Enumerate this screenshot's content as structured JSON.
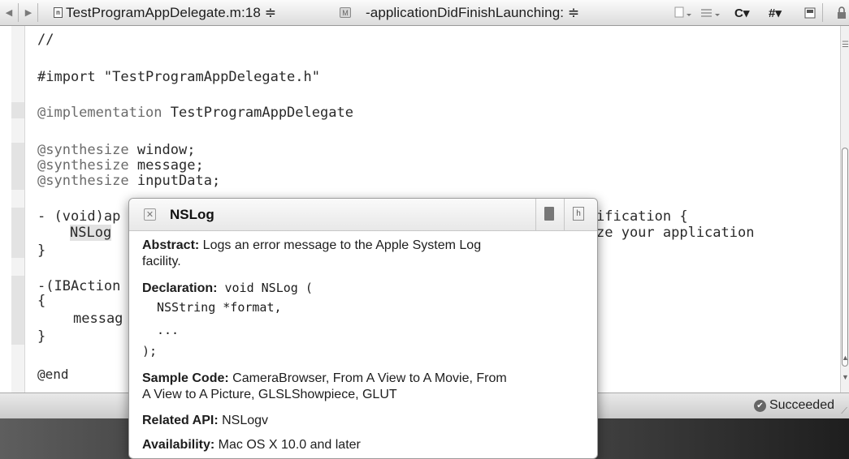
{
  "jumpbar": {
    "back_arrow": "◀",
    "forward_arrow": "▶",
    "file_icon_glyph": "m",
    "file_crumb": "TestProgramAppDelegate.m:18 ≑",
    "method_icon_glyph": "M",
    "method_crumb": "-applicationDidFinishLaunching: ≑",
    "icons": [
      "doc-menu-icon",
      "lines-menu-icon",
      "counterparts-icon",
      "includes-icon",
      "split-editor-icon",
      "lock-icon"
    ],
    "counterparts_label": "C▾",
    "includes_label": "#▾"
  },
  "code": {
    "l1": "//",
    "l2": "#import \"TestProgramAppDelegate.h\"",
    "l3_kw": "@implementation",
    "l3_rest": " TestProgramAppDelegate",
    "l4_kw": "@synthesize",
    "l4_rest": " window;",
    "l5_kw": "@synthesize",
    "l5_rest": " message;",
    "l6_kw": "@synthesize",
    "l6_rest": " inputData;",
    "l7_left": "- (void)ap",
    "l7_right": "ification {",
    "l8_left": "NSLog",
    "l8_right": "ze your application",
    "l9": "}",
    "l10": "-(IBAction",
    "l11": "{",
    "l12": "messag",
    "l13": "}",
    "l14": "@end"
  },
  "popover": {
    "title": "NSLog",
    "abstract_label": "Abstract:",
    "abstract_text1": " Logs an error message to the Apple System Log",
    "abstract_text2": "facility.",
    "declaration_label": "Declaration:",
    "declaration_sig": " void NSLog (",
    "decl_param": "NSString *format,",
    "decl_ellipsis": "...",
    "decl_close": ");",
    "sample_label": "Sample Code:",
    "sample_text1": " CameraBrowser, From A View to A Movie, From",
    "sample_text2": "A View to A Picture, GLSLShowpiece, GLUT",
    "related_label": "Related API:",
    "related_text": " NSLogv",
    "availability_label": "Availability:",
    "availability_text": " Mac OS X 10.0 and later"
  },
  "status": {
    "text": "Succeeded"
  }
}
